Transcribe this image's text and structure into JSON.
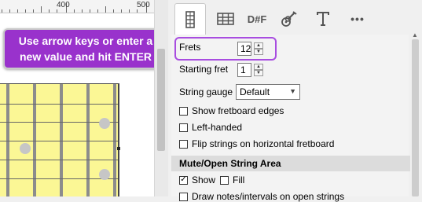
{
  "ruler": {
    "labels": [
      "400",
      "500"
    ]
  },
  "tooltip": {
    "line1": "Use arrow keys or enter a",
    "line2": "new value and hit ENTER"
  },
  "tabs": [
    {
      "name": "fretboard-tab",
      "icon": "fretboard-icon",
      "label": ""
    },
    {
      "name": "grid-tab",
      "icon": "grid-icon",
      "label": ""
    },
    {
      "name": "notes-tab",
      "icon": "",
      "label": "D#F"
    },
    {
      "name": "instrument-tab",
      "icon": "guitar-icon",
      "label": ""
    },
    {
      "name": "text-tab",
      "icon": "text-format-icon",
      "label": ""
    },
    {
      "name": "more-tab",
      "icon": "more-icon",
      "label": "•••"
    }
  ],
  "settings": {
    "frets_label": "Frets",
    "frets_value": "12",
    "starting_fret_label": "Starting fret",
    "starting_fret_value": "1",
    "string_gauge_label": "String gauge",
    "string_gauge_value": "Default",
    "show_edges_label": "Show fretboard edges",
    "left_handed_label": "Left-handed",
    "flip_strings_label": "Flip strings on horizontal fretboard",
    "section_title": "Mute/Open String Area",
    "show_label": "Show",
    "fill_label": "Fill",
    "draw_notes_label": "Draw notes/intervals on open strings"
  }
}
